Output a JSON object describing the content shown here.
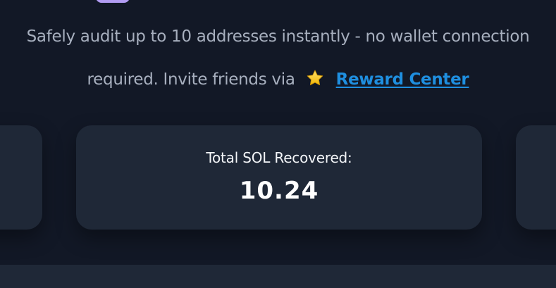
{
  "description": {
    "line1": "Safely audit up to 10 addresses instantly - no wallet connection",
    "line2": "required. Invite friends via",
    "star_icon": "star-icon",
    "reward_link": "Reward Center"
  },
  "stats": {
    "total_sol_label": "Total SOL Recovered:",
    "total_sol_value": "10.24"
  },
  "colors": {
    "page_background": "#121826",
    "card_background": "#1f2837",
    "link": "#1f8fe0",
    "muted_text": "#a7afbe"
  }
}
